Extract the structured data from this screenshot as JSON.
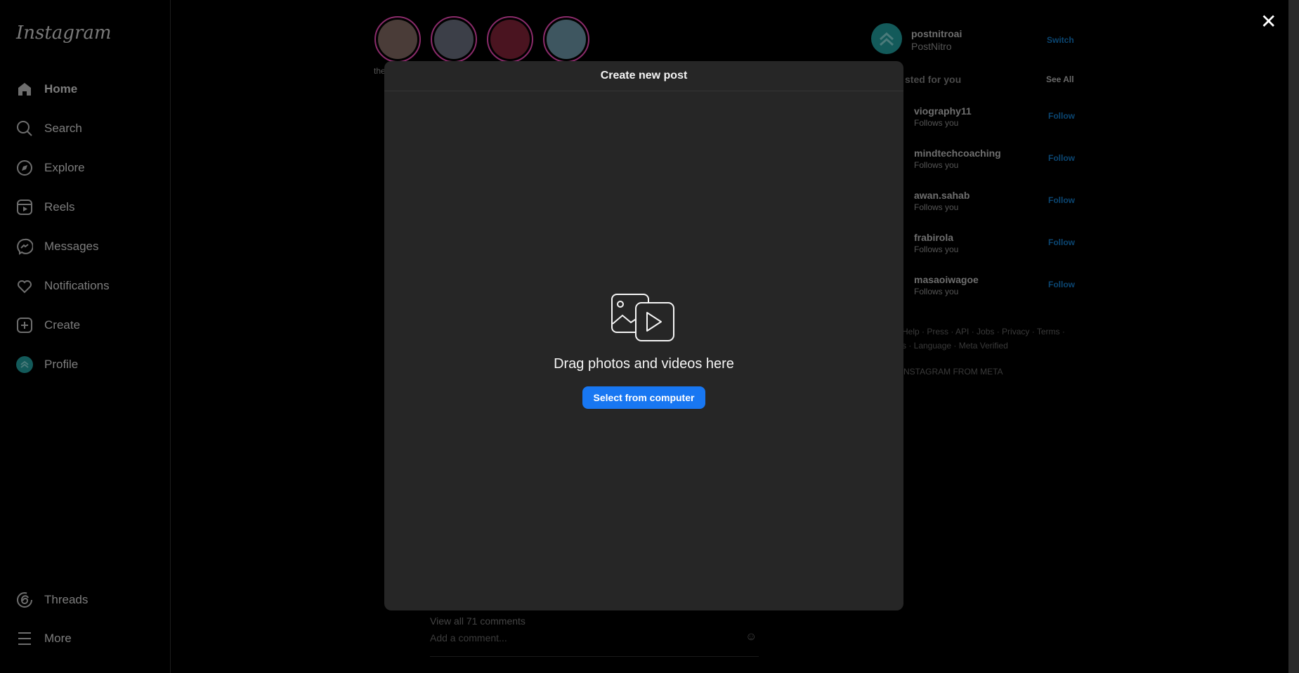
{
  "sidebar": {
    "logo": "Instagram",
    "items": [
      {
        "label": "Home",
        "icon": "home-icon"
      },
      {
        "label": "Search",
        "icon": "search-icon"
      },
      {
        "label": "Explore",
        "icon": "compass-icon"
      },
      {
        "label": "Reels",
        "icon": "reels-icon"
      },
      {
        "label": "Messages",
        "icon": "messenger-icon"
      },
      {
        "label": "Notifications",
        "icon": "heart-icon"
      },
      {
        "label": "Create",
        "icon": "plus-square-icon"
      },
      {
        "label": "Profile",
        "icon": "avatar"
      }
    ],
    "bottom": [
      {
        "label": "Threads",
        "icon": "threads-icon"
      },
      {
        "label": "More",
        "icon": "menu-icon"
      }
    ]
  },
  "stories": {
    "first_label_partial": "the"
  },
  "modal": {
    "title": "Create new post",
    "drag_text": "Drag photos and videos here",
    "select_button": "Select from computer"
  },
  "feed": {
    "view_comments": "View all 71 comments",
    "comment_placeholder": "Add a comment..."
  },
  "right": {
    "username": "postnitroai",
    "fullname": "PostNitro",
    "switch": "Switch",
    "suggested_partial": "sted for you",
    "see_all": "See All",
    "suggestions": [
      {
        "name": "viography11",
        "sub": "Follows you",
        "action": "Follow"
      },
      {
        "name": "mindtechcoaching",
        "sub": "Follows you",
        "action": "Follow"
      },
      {
        "name": "awan.sahab",
        "sub": "Follows you",
        "action": "Follow"
      },
      {
        "name": "frabirola",
        "sub": "Follows you",
        "action": "Follow"
      },
      {
        "name": "masaoiwagoe",
        "sub": "Follows you",
        "action": "Follow"
      }
    ],
    "footer_line1": "Help · Press · API · Jobs · Privacy · Terms ·",
    "footer_line2": "s · Language · Meta Verified",
    "copyright": "NSTAGRAM FROM META"
  },
  "colors": {
    "primary_button": "#1877f2",
    "modal_bg": "#262626"
  }
}
